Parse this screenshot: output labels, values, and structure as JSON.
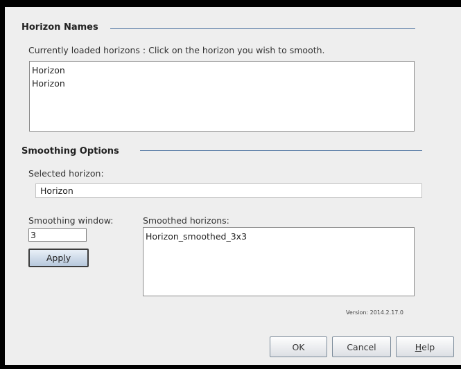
{
  "horizon_names": {
    "title": "Horizon Names",
    "instruction": "Currently loaded horizons :  Click on the horizon you wish to smooth.",
    "loaded_horizons": [
      "Horizon",
      "Horizon"
    ]
  },
  "smoothing_options": {
    "title": "Smoothing Options",
    "selected_label": "Selected horizon:",
    "selected_value": "Horizon",
    "window_label": "Smoothing window:",
    "window_value": "3",
    "apply_label_before": "App",
    "apply_label_mnemonic": "l",
    "apply_label_after": "y",
    "smoothed_label": "Smoothed horizons:",
    "smoothed_horizons": [
      "Horizon_smoothed_3x3"
    ]
  },
  "version": "Version: 2014.2.17.0",
  "footer": {
    "ok_label": "OK",
    "cancel_label": "Cancel",
    "help_label_mnemonic": "H",
    "help_label_rest": "elp"
  }
}
